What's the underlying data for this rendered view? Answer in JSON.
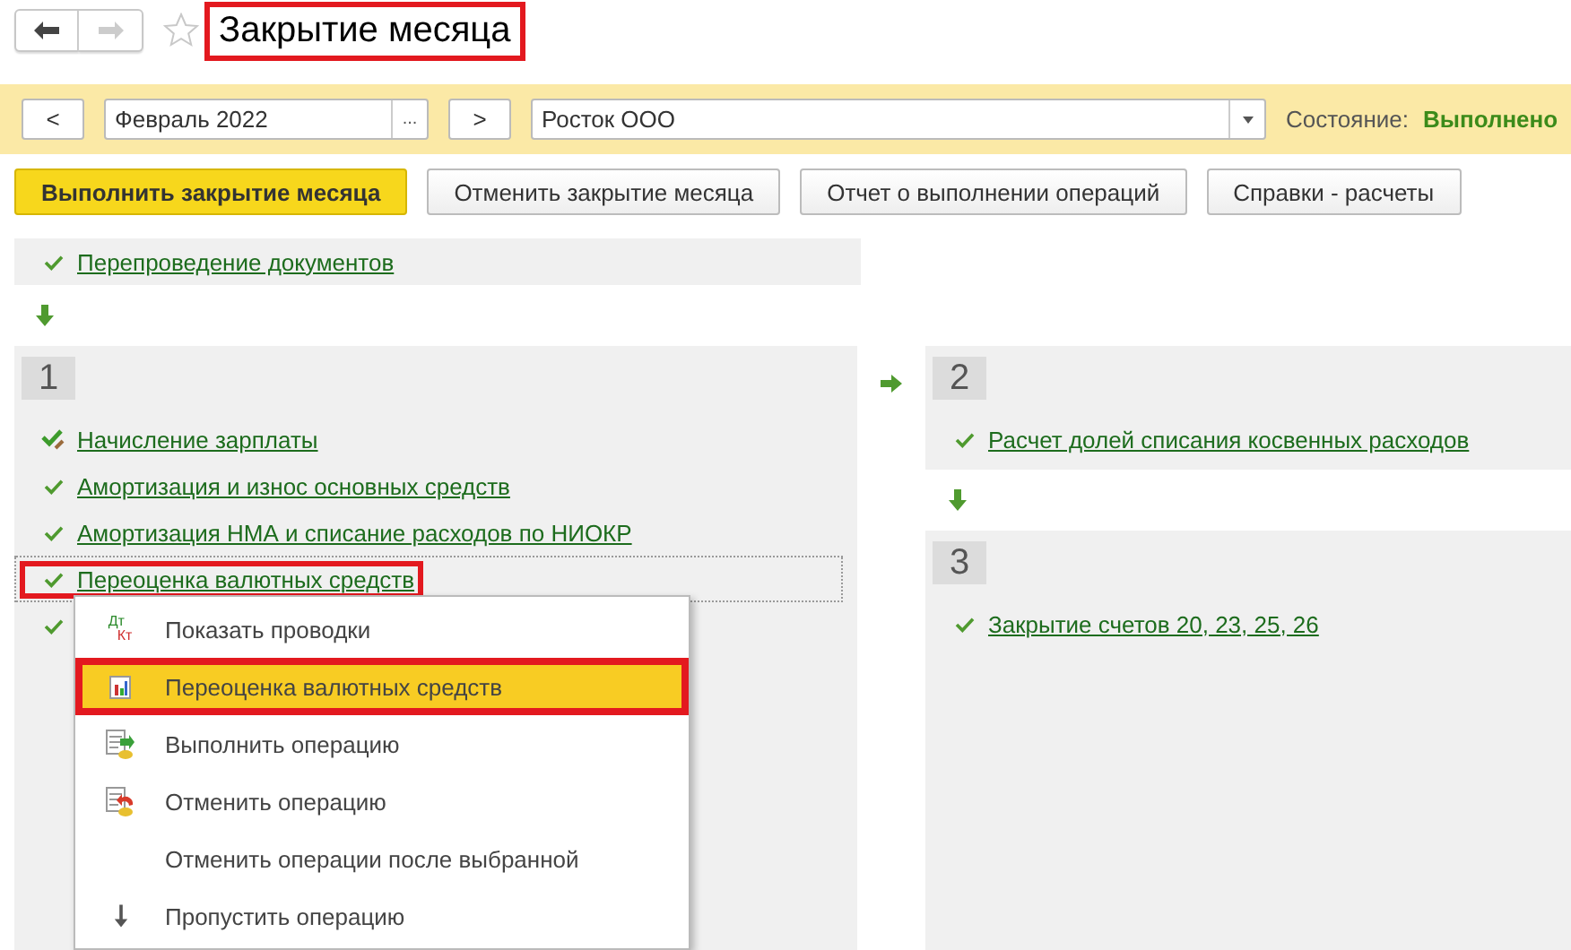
{
  "nav": {
    "back": {
      "disabled": false
    },
    "forward": {
      "disabled": true
    },
    "favorite": {
      "on": false
    }
  },
  "title": {
    "text": "Закрытие месяца",
    "highlighted": true
  },
  "period_bar": {
    "prev": "<",
    "period": "Февраль 2022",
    "choose": "...",
    "next": ">",
    "organization": "Росток ООО",
    "state_label": "Состояние:",
    "state_value": "Выполнено"
  },
  "buttons": [
    {
      "label": "Выполнить закрытие месяца",
      "kind": "primary"
    },
    {
      "label": "Отменить закрытие месяца",
      "kind": "default"
    },
    {
      "label": "Отчет о выполнении операций",
      "kind": "default"
    },
    {
      "label": "Справки - расчеты",
      "kind": "default"
    }
  ],
  "preliminary": {
    "label": "Перепроведение документов",
    "kind": "done"
  },
  "stages": [
    {
      "number": "1",
      "items": [
        {
          "label": "Начисление зарплаты",
          "kind": "edited",
          "selected": false,
          "highlighted": false
        },
        {
          "label": "Амортизация и износ основных средств",
          "kind": "done",
          "selected": false,
          "highlighted": false
        },
        {
          "label": "Амортизация НМА и списание расходов по НИОКР",
          "kind": "done",
          "selected": false,
          "highlighted": false
        },
        {
          "label": "Переоценка валютных средств",
          "kind": "done",
          "selected": true,
          "highlighted": true
        },
        {
          "kind": "done",
          "selected": false,
          "highlighted": false
        }
      ]
    },
    {
      "number": "2",
      "items": [
        {
          "label": "Расчет долей списания косвенных расходов",
          "kind": "done",
          "selected": false,
          "highlighted": false
        }
      ]
    },
    {
      "number": "3",
      "items": [
        {
          "label": "Закрытие счетов 20, 23, 25, 26",
          "kind": "done",
          "selected": false,
          "highlighted": false
        }
      ]
    }
  ],
  "context_menu": [
    {
      "label": "Показать проводки",
      "kind": "postings",
      "icon_text": [
        "Дт",
        "Кт"
      ],
      "selected": false,
      "highlighted": false
    },
    {
      "label": "Переоценка валютных средств",
      "kind": "report",
      "selected": true,
      "highlighted": true
    },
    {
      "label": "Выполнить операцию",
      "kind": "run",
      "selected": false,
      "highlighted": false
    },
    {
      "label": "Отменить операцию",
      "kind": "cancel",
      "selected": false,
      "highlighted": false
    },
    {
      "label": "Отменить операции после выбранной",
      "kind": "plain",
      "selected": false,
      "highlighted": false
    },
    {
      "label": "Пропустить операцию",
      "kind": "skip",
      "selected": false,
      "highlighted": false
    }
  ]
}
